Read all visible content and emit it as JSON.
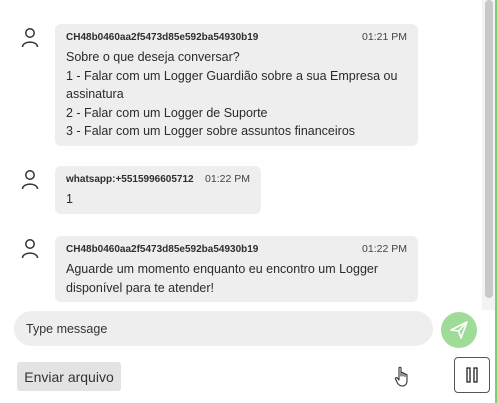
{
  "messages": [
    {
      "sender": "CH48b0460aa2f5473d85e592ba54930b19",
      "time": "01:21 PM",
      "lines": [
        "Sobre o que deseja conversar?",
        "1 - Falar com um Logger Guardião sobre a sua Empresa ou",
        "assinatura",
        "2 - Falar com um Logger de Suporte",
        "3 - Falar com um Logger sobre assuntos financeiros"
      ]
    },
    {
      "sender": "whatsapp:+5515996605712",
      "time": "01:22 PM",
      "lines": [
        "1"
      ]
    },
    {
      "sender": "CH48b0460aa2f5473d85e592ba54930b19",
      "time": "01:22 PM",
      "lines": [
        "Aguarde um momento enquanto eu encontro um Logger",
        "disponível para te atender!"
      ]
    }
  ],
  "composer": {
    "placeholder": "Type message"
  },
  "upload_label": "Enviar arquivo",
  "icons": {
    "avatar": "user-avatar-icon",
    "send": "send-icon",
    "pause": "pause-icon",
    "cursor": "hand-pointer-icon"
  },
  "colors": {
    "bubble": "#eeeeef",
    "send_button": "#9fdc98",
    "accent_edge": "#7ad16a"
  }
}
